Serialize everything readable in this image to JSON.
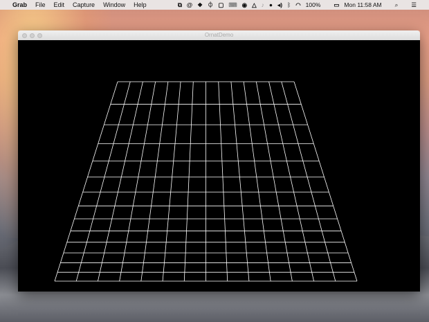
{
  "menubar": {
    "apple": "",
    "app": "Grab",
    "items": [
      "File",
      "Edit",
      "Capture",
      "Window",
      "Help"
    ],
    "tray_icons": [
      "copy-icon",
      "at-icon",
      "dropbox-icon",
      "robot-icon",
      "window-icon",
      "keyboard-icon",
      "send-icon",
      "drive-icon",
      "bell-icon",
      "balloon-icon",
      "volume-icon",
      "bluetooth-icon",
      "wifi-icon"
    ],
    "battery": "100%",
    "clock": "Mon 11:58 AM",
    "search_icon": "⌕",
    "list_icon": "☰"
  },
  "window": {
    "title": "OrnatDemo"
  },
  "grid": {
    "columns": 14,
    "rows": 14,
    "line_color": "#ffffff",
    "background": "#000000"
  }
}
